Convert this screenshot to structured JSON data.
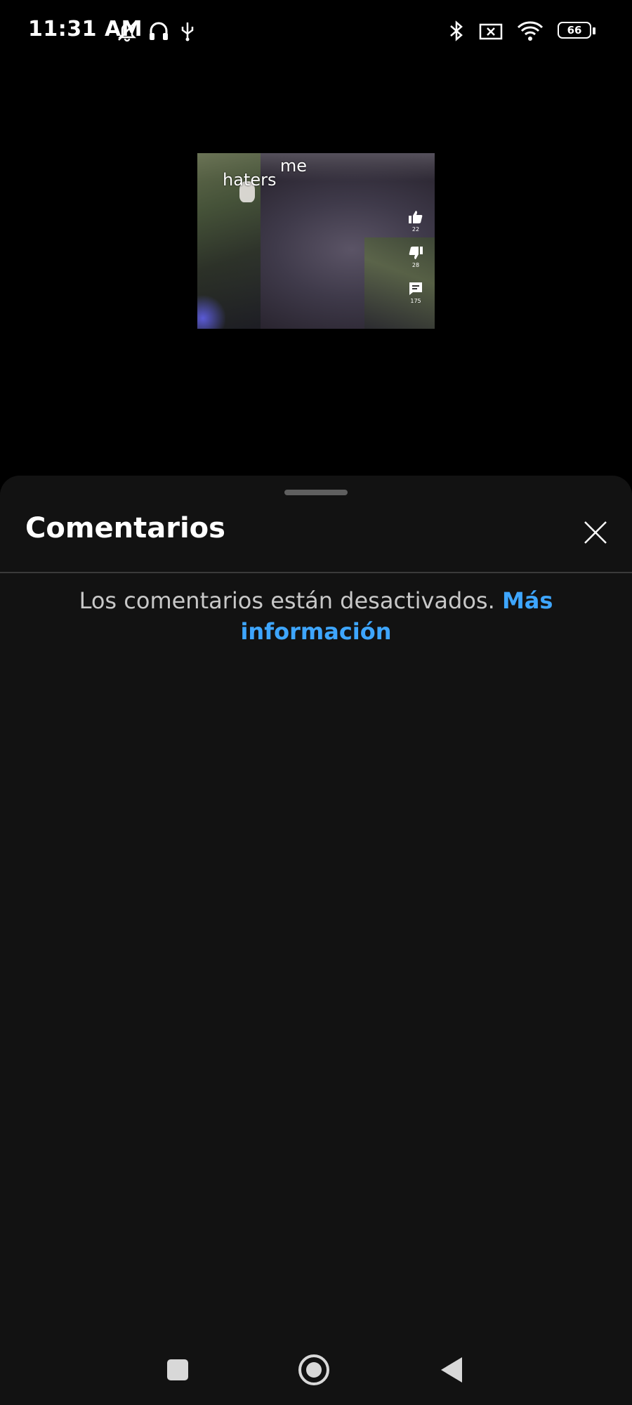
{
  "status_bar": {
    "time": "11:31 AM",
    "battery_level": "66",
    "icons_left": [
      "bell-off-icon",
      "headphones-icon",
      "usb-icon"
    ],
    "icons_right": [
      "bluetooth-icon",
      "sim-off-icon",
      "wifi-icon",
      "battery-icon"
    ]
  },
  "video": {
    "caption_line1": "me",
    "caption_line2": "haters",
    "like_count": "22",
    "dislike_count": "28",
    "comment_count": "175"
  },
  "comments_sheet": {
    "title": "Comentarios",
    "close_icon": "close-icon",
    "disabled_message": "Los comentarios están desactivados.",
    "learn_more_link": "Más información",
    "link_color": "#3ea6ff"
  },
  "nav_bar": {
    "recents_icon": "square-icon",
    "home_icon": "circle-icon",
    "back_icon": "triangle-back-icon"
  }
}
